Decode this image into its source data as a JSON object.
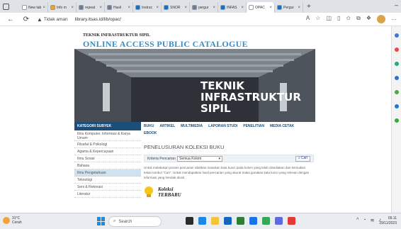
{
  "browser": {
    "tabs": [
      {
        "label": "New tab",
        "color": "#ffffff",
        "active": false
      },
      {
        "label": "Info m",
        "color": "#e4a72a",
        "active": false
      },
      {
        "label": "repeat",
        "color": "#6b7d8f",
        "active": false
      },
      {
        "label": "Hasil",
        "color": "#6b7d8f",
        "active": false
      },
      {
        "label": "Instruc",
        "color": "#1c6ec2",
        "active": false
      },
      {
        "label": "SNOR",
        "color": "#1c6ec2",
        "active": false
      },
      {
        "label": "pergur",
        "color": "#6b7d8f",
        "active": false
      },
      {
        "label": "INFAS",
        "color": "#1c6ec2",
        "active": false
      },
      {
        "label": "OPAC",
        "color": "#ffffff",
        "active": true
      },
      {
        "label": "Pergur",
        "color": "#1c6ec2",
        "active": false
      }
    ],
    "new_tab_icon": "plus-icon",
    "minimize_icon": "minimize-icon",
    "security_warning": "Tidak aman",
    "url": "library.itsas.id/lib/opac/"
  },
  "site": {
    "subtitle": "TEKNIK INFRASTRUKTUR SIPIL",
    "title": "ONLINE ACCESS PUBLIC CATALOGUE",
    "banner_lines": [
      "TEKNIK",
      "INFRASTRUKTUR",
      "SIPIL"
    ],
    "sidebar_title": "KATEGORI SUBYEK",
    "subjects": [
      "Ilmu Komputer, Informasi & Karya Umum",
      "Filsafat & Psikologi",
      "Agama & Kepercayaan",
      "Ilmu Sosial",
      "Bahasa",
      "Ilmu Pengetahuan",
      "Teknologi",
      "Seni & Rekreasi",
      "Literatur"
    ],
    "menu": [
      "BUKU",
      "ARTIKEL",
      "MULTIMEDIA",
      "LAPORAN STUDI",
      "PENELITIAN",
      "MEDIA CETAK"
    ],
    "menu_second_row": "EBOOK",
    "search": {
      "heading": "PENELUSURAN KOLEKSI BUKU",
      "criteria_label": "Kriteria Pencarian",
      "selected": "Semua Kolom",
      "button": "Cari"
    },
    "description": "Untuk melakukan proses pencarian silahkan masukan kata kunci pada kolom yang telah disediakan dan kemudian tekan tombol \"Cari\". Untuk mendapatkan hasil pencarian yang akurat maka gunakan kata kunci yang relevan dengan informasi yang hendak dicari.",
    "newest_label": [
      "Koleksi",
      "TERBARU"
    ]
  },
  "taskbar": {
    "weather_temp": "31°C",
    "weather_desc": "Cerah",
    "search_placeholder": "Search",
    "time": "09.11",
    "date": "29/11/2023"
  }
}
